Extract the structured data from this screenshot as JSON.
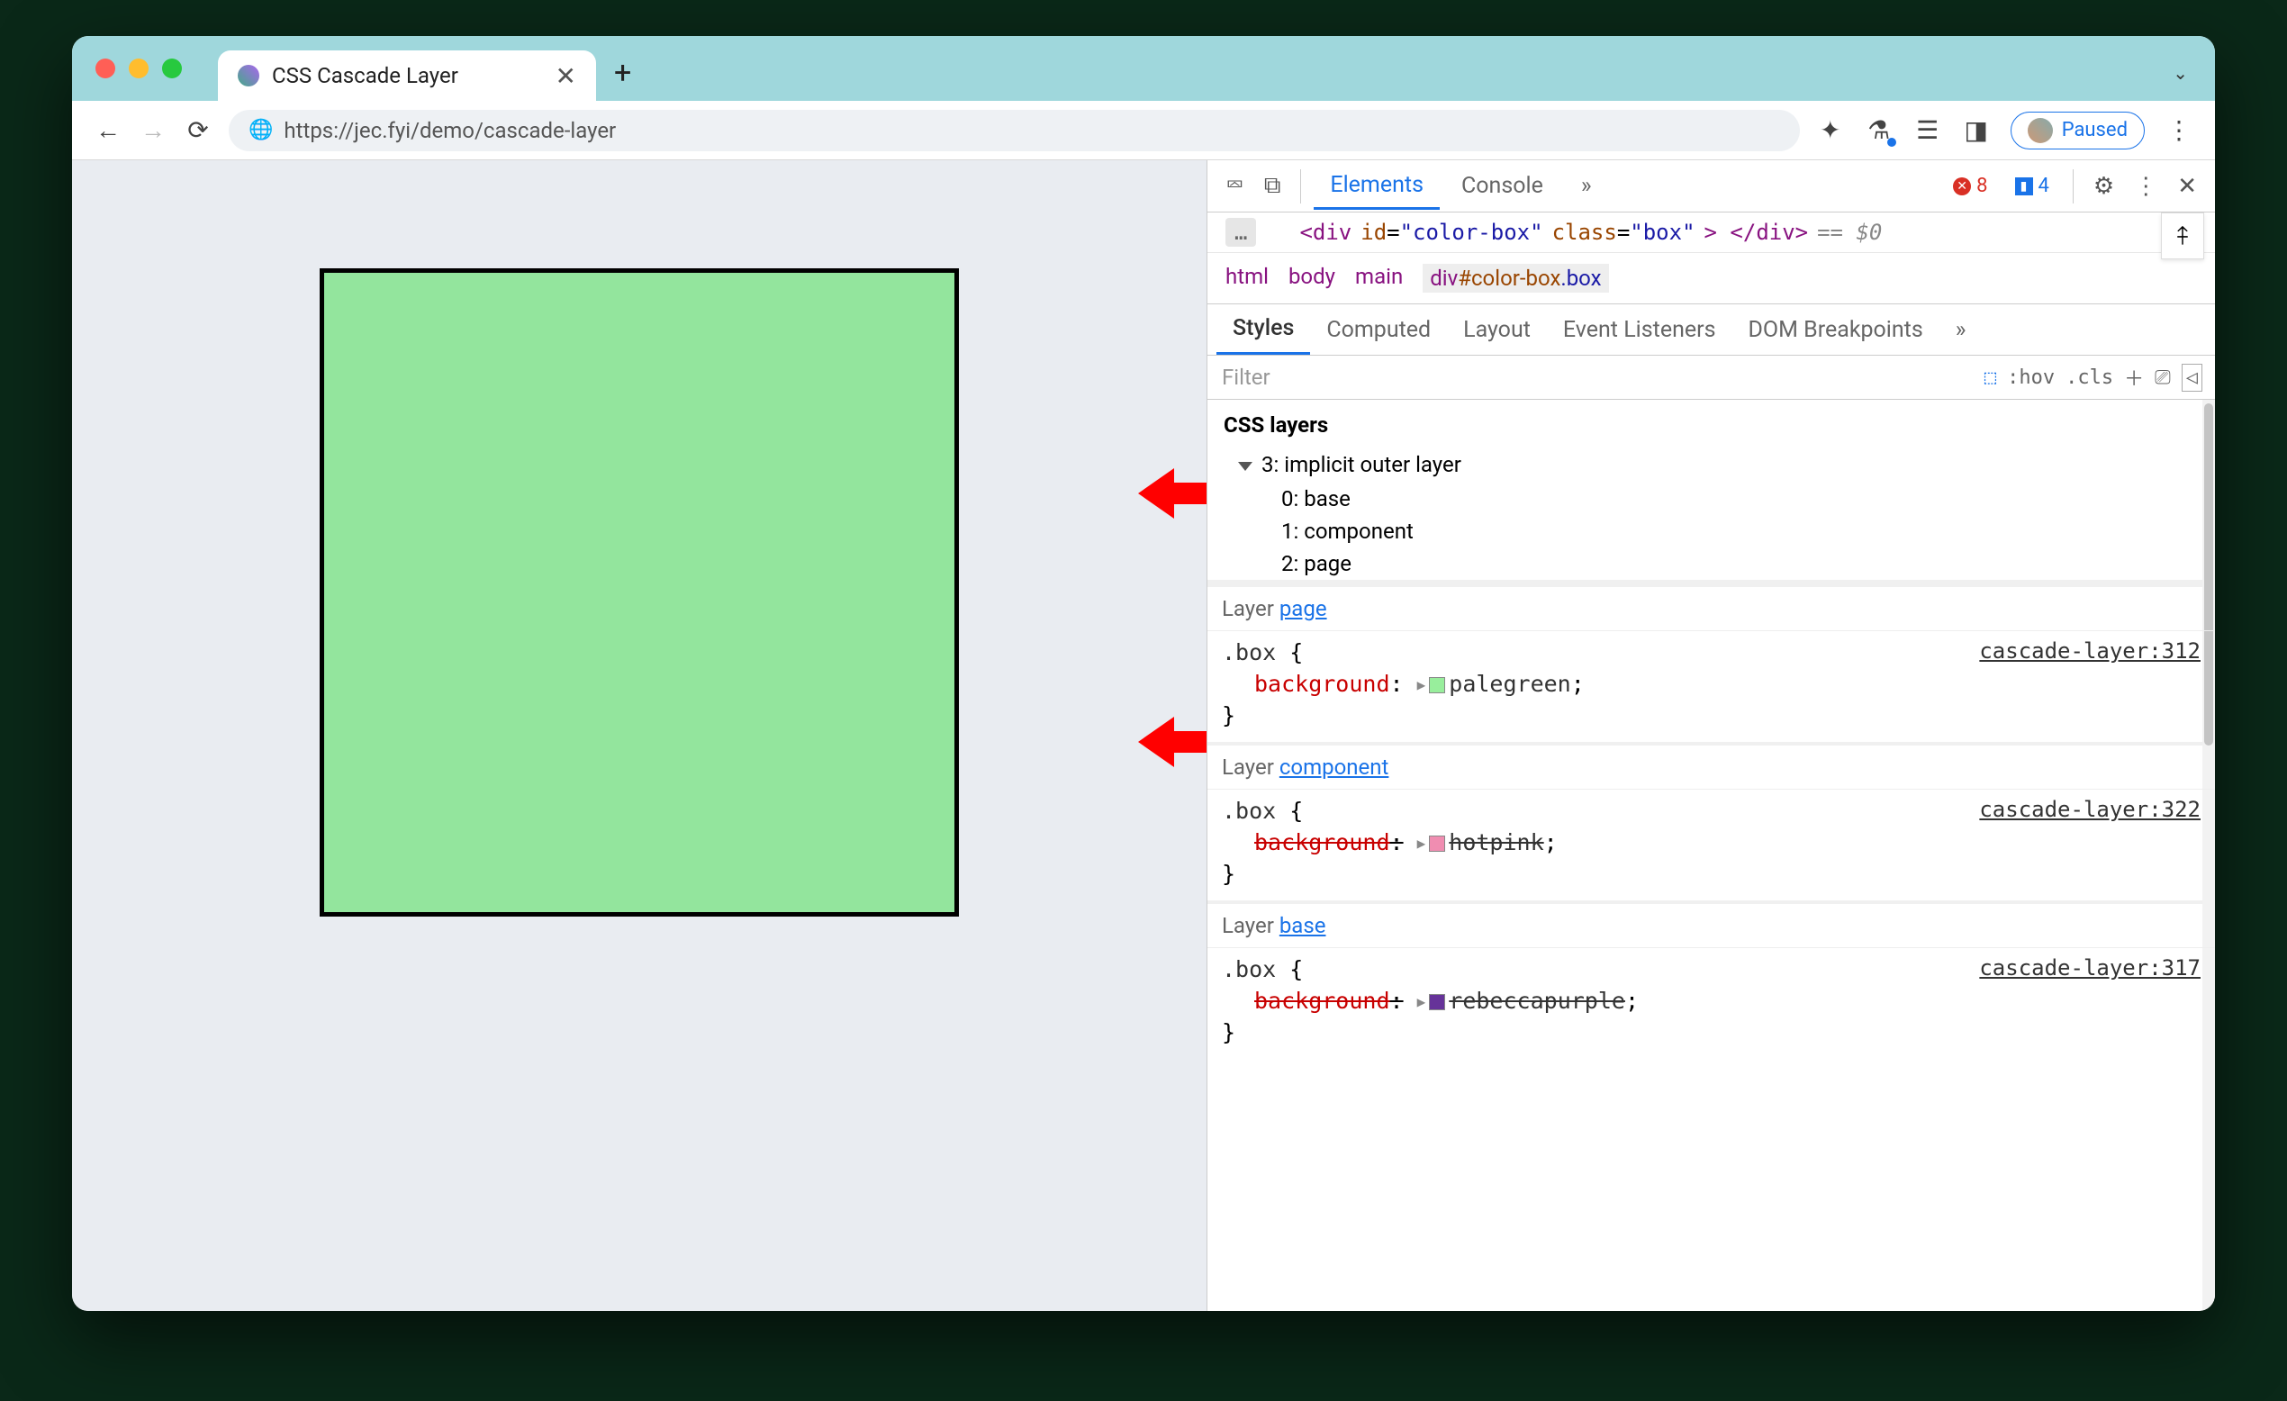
{
  "browser": {
    "tab_title": "CSS Cascade Layer",
    "url": "https://jec.fyi/demo/cascade-layer",
    "paused_label": "Paused"
  },
  "devtools": {
    "top_tabs": {
      "elements": "Elements",
      "console": "Console",
      "more": "»"
    },
    "errors": "8",
    "infos": "4",
    "element_html": {
      "tag_open": "<div",
      "id_attr": "id",
      "id_val": "\"color-box\"",
      "class_attr": "class",
      "class_val": "\"box\"",
      "tag_close": "> </div>",
      "sel_marker": "== $0"
    },
    "breadcrumb": [
      "html",
      "body",
      "main",
      "div#color-box.box"
    ],
    "styles_tabs": [
      "Styles",
      "Computed",
      "Layout",
      "Event Listeners",
      "DOM Breakpoints",
      "»"
    ],
    "filter_placeholder": "Filter",
    "filter_tools": {
      "hov": ":hov",
      "cls": ".cls"
    },
    "css_layers": {
      "title": "CSS layers",
      "root": "3: implicit outer layer",
      "children": [
        "0: base",
        "1: component",
        "2: page"
      ],
      "selected": 2
    },
    "rules": [
      {
        "layer_label": "Layer ",
        "layer_link": "page",
        "selector": ".box",
        "source": "cascade-layer:312",
        "prop_name": "background",
        "prop_value": "palegreen",
        "swatch": "#98ee9c",
        "struck": false
      },
      {
        "layer_label": "Layer ",
        "layer_link": "component",
        "selector": ".box",
        "source": "cascade-layer:322",
        "prop_name": "background",
        "prop_value": "hotpink",
        "swatch": "#f08db1",
        "struck": true
      },
      {
        "layer_label": "Layer ",
        "layer_link": "base",
        "selector": ".box",
        "source": "cascade-layer:317",
        "prop_name": "background",
        "prop_value": "rebeccapurple",
        "swatch": "#663399",
        "struck": true
      }
    ]
  }
}
